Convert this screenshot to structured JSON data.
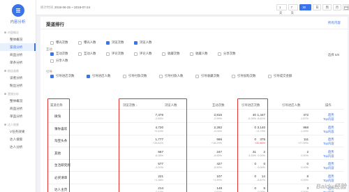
{
  "app": {
    "title": "内容分析"
  },
  "sidebar": {
    "groups": [
      {
        "label": "内容概况",
        "items": [
          "整体概况",
          "渠道分析",
          "商品分析",
          "单条分析"
        ]
      },
      {
        "label": "粉丝画像",
        "items": [
          "读者分析",
          "粉丝分析"
        ]
      },
      {
        "label": "营销分析",
        "items": [
          "整体概况",
          "商品分析",
          "单品分析"
        ]
      },
      {
        "label": "达人效果",
        "items": [
          "V任务效果",
          "达人搜索",
          "达人分析"
        ]
      }
    ],
    "active_item": "渠道分析"
  },
  "topbar": {
    "date_label": "统计时间",
    "date_range": "2018-06-25 ~ 2018-07-24",
    "range_buttons": [
      "1天",
      "7天",
      "30天",
      "日",
      "周",
      "月"
    ],
    "active_range": "30天"
  },
  "card": {
    "title": "渠道排行",
    "action": "所有内容",
    "selected_count": "选择 5/8",
    "filters": {
      "g1": {
        "label": "",
        "items": [
          {
            "text": "曝光次数",
            "checked": false
          },
          {
            "text": "曝光人数",
            "checked": false
          },
          {
            "text": "浏览次数",
            "checked": true
          },
          {
            "text": "浏览人数",
            "checked": true
          }
        ]
      },
      "g2": {
        "label": "互动",
        "items": [
          {
            "text": "互动次数",
            "checked": true
          },
          {
            "text": "互动人数",
            "checked": false
          },
          {
            "text": "评论次数",
            "checked": false
          },
          {
            "text": "评论人数",
            "checked": false
          },
          {
            "text": "收藏次数",
            "checked": false
          },
          {
            "text": "收藏人数",
            "checked": false
          },
          {
            "text": "分享次数",
            "checked": false
          },
          {
            "text": "分享人数",
            "checked": false
          }
        ]
      },
      "g3": {
        "label": "引导",
        "items": [
          {
            "text": "引导进店次数",
            "checked": true
          },
          {
            "text": "引导进店人数",
            "checked": true
          },
          {
            "text": "引导付款次数",
            "checked": false
          },
          {
            "text": "引导付款人数",
            "checked": false
          },
          {
            "text": "引导收藏次数",
            "checked": false
          },
          {
            "text": "引导加购次数",
            "checked": false
          },
          {
            "text": "引导成交金额",
            "checked": false
          }
        ]
      }
    }
  },
  "table": {
    "headers": {
      "name": "渠道名称",
      "views": "浏览次数",
      "visitors": "浏览人数",
      "interactions": "互动次数",
      "store_visits": "引导进店次数",
      "store_visitors": "引导进店人数",
      "ops": "操作"
    },
    "rows": [
      {
        "name": "微淘",
        "views": "7,376",
        "views_chg": "-2.65%",
        "visitors": "2,815",
        "visitors_chg": "-2.99%",
        "inter": "40",
        "inter_chg": "-5.26%",
        "sv": "1,447",
        "sv_chg": "-8.61%",
        "svr": "472",
        "svr_chg": "-1.67%",
        "ops": [
          "趋势",
          "Top内容"
        ]
      },
      {
        "name": "猜你喜欢",
        "views": "4,720",
        "views_chg": "+0.43%",
        "visitors": "2,282",
        "visitors_chg": "-0.04%",
        "inter": "0",
        "inter_chg": "-",
        "sv": "3,140",
        "sv_chg": "+3.73%",
        "svr": "868",
        "svr_chg": "-1.33%",
        "ops": [
          "趋势",
          "Top内容"
        ]
      },
      {
        "name": "淘宝头条",
        "views": "1,777",
        "views_chg": "+26.61%",
        "visitors": "666",
        "visitors_chg": "+18.29%",
        "inter": "0",
        "inter_chg": "-",
        "sv": "375",
        "sv_chg": "+32.86%",
        "svr": "111",
        "svr_chg": "+27.59%",
        "ops": [
          "趋势",
          "Top内容"
        ]
      },
      {
        "name": "其他",
        "views": "567",
        "views_chg": "-6.38%",
        "visitors": "247",
        "visitors_chg": "-8.55%",
        "inter": "31",
        "inter_chg": "-3.33%",
        "sv": "2",
        "sv_chg": "0.00%",
        "svr": "2",
        "svr_chg": "0.00%",
        "ops": [
          "趋势",
          "Top内容"
        ]
      },
      {
        "name": "生活研究所",
        "views": "577",
        "views_chg": "-4.20%",
        "visitors": "427",
        "visitors_chg": "-5.50%",
        "inter": "0",
        "inter_chg": "-",
        "sv": "0",
        "sv_chg": "0.00%",
        "svr": "0",
        "svr_chg": "0.00%",
        "ops": [
          "趋势",
          "Top内容"
        ]
      },
      {
        "name": "必买清单",
        "views": "221",
        "views_chg": "+1.38%",
        "visitors": "107",
        "visitors_chg": "+1.90%",
        "inter": "0",
        "inter_chg": "-",
        "sv": "14",
        "sv_chg": "-6.67%",
        "svr": "8",
        "svr_chg": "0.00%",
        "ops": [
          "趋势",
          "Top内容"
        ]
      },
      {
        "name": "达人主页",
        "views": "214",
        "views_chg": "-0.47%",
        "visitors": "148",
        "visitors_chg": "-0.67%",
        "inter": "0",
        "inter_chg": "-",
        "sv": "5",
        "sv_chg": "0.00%",
        "svr": "3",
        "svr_chg": "0.00%",
        "ops": [
          "趋势",
          "Top内容"
        ]
      }
    ]
  },
  "watermark": "Baidu经验"
}
